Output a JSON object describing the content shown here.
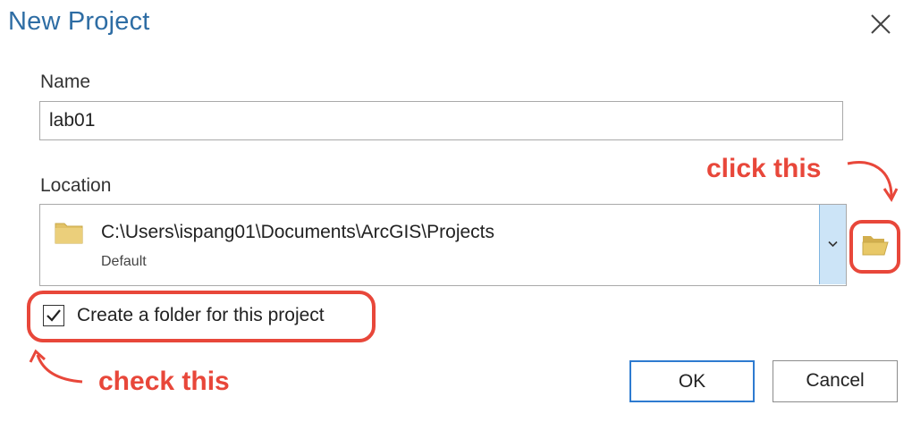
{
  "dialog": {
    "title": "New Project"
  },
  "name_field": {
    "label": "Name",
    "value": "lab01"
  },
  "location_field": {
    "label": "Location",
    "path": "C:\\Users\\ispang01\\Documents\\ArcGIS\\Projects",
    "subtitle": "Default"
  },
  "checkbox": {
    "label": "Create a folder for this project",
    "checked": true
  },
  "buttons": {
    "ok": "OK",
    "cancel": "Cancel"
  },
  "annotations": {
    "click_hint": "click this",
    "check_hint": "check this",
    "color": "#e8473a"
  },
  "icons": {
    "close": "close-icon",
    "folder": "folder-icon",
    "chevron": "chevron-down-icon",
    "browse": "open-folder-icon",
    "check": "checkmark-icon"
  },
  "colors": {
    "title": "#2e6da4",
    "folder": "#e2c266",
    "dropdown_bg": "#cce4f7",
    "ok_border": "#2e7bd0"
  }
}
